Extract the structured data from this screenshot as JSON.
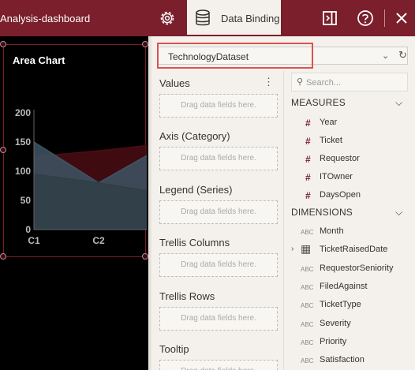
{
  "header": {
    "app_title": "Analysis-dashboard",
    "active_tab_label": "Data Binding"
  },
  "chart": {
    "title": "Area Chart",
    "chart_data": {
      "type": "area",
      "categories": [
        "C1",
        "C2"
      ],
      "y_ticks": [
        "200",
        "150",
        "100",
        "50",
        "0"
      ],
      "ylim": [
        0,
        200
      ],
      "series": [
        {
          "values": [
            125,
            135
          ],
          "color": "#4a0d14"
        },
        {
          "values": [
            150,
            80
          ],
          "color": "#3e5564"
        },
        {
          "values": [
            95,
            80
          ],
          "color": "#2f3e47"
        }
      ]
    }
  },
  "panel": {
    "dataset": "TechnologyDataset",
    "wells": [
      {
        "label": "Values",
        "placeholder": "Drag data fields here."
      },
      {
        "label": "Axis (Category)",
        "placeholder": "Drag data fields here."
      },
      {
        "label": "Legend (Series)",
        "placeholder": "Drag data fields here."
      },
      {
        "label": "Trellis Columns",
        "placeholder": "Drag data fields here."
      },
      {
        "label": "Trellis Rows",
        "placeholder": "Drag data fields here."
      },
      {
        "label": "Tooltip",
        "placeholder": "Drag data fields here."
      }
    ],
    "search_placeholder": "Search...",
    "measures_label": "MEASURES",
    "measures": [
      "Year",
      "Ticket",
      "Requestor",
      "ITOwner",
      "DaysOpen"
    ],
    "dimensions_label": "DIMENSIONS",
    "dimensions": [
      {
        "name": "Month",
        "type": "ABC"
      },
      {
        "name": "TicketRaisedDate",
        "type": "date"
      },
      {
        "name": "RequestorSeniority",
        "type": "ABC"
      },
      {
        "name": "FiledAgainst",
        "type": "ABC"
      },
      {
        "name": "TicketType",
        "type": "ABC"
      },
      {
        "name": "Severity",
        "type": "ABC"
      },
      {
        "name": "Priority",
        "type": "ABC"
      },
      {
        "name": "Satisfaction",
        "type": "ABC"
      }
    ],
    "measure_symbol": "#"
  }
}
